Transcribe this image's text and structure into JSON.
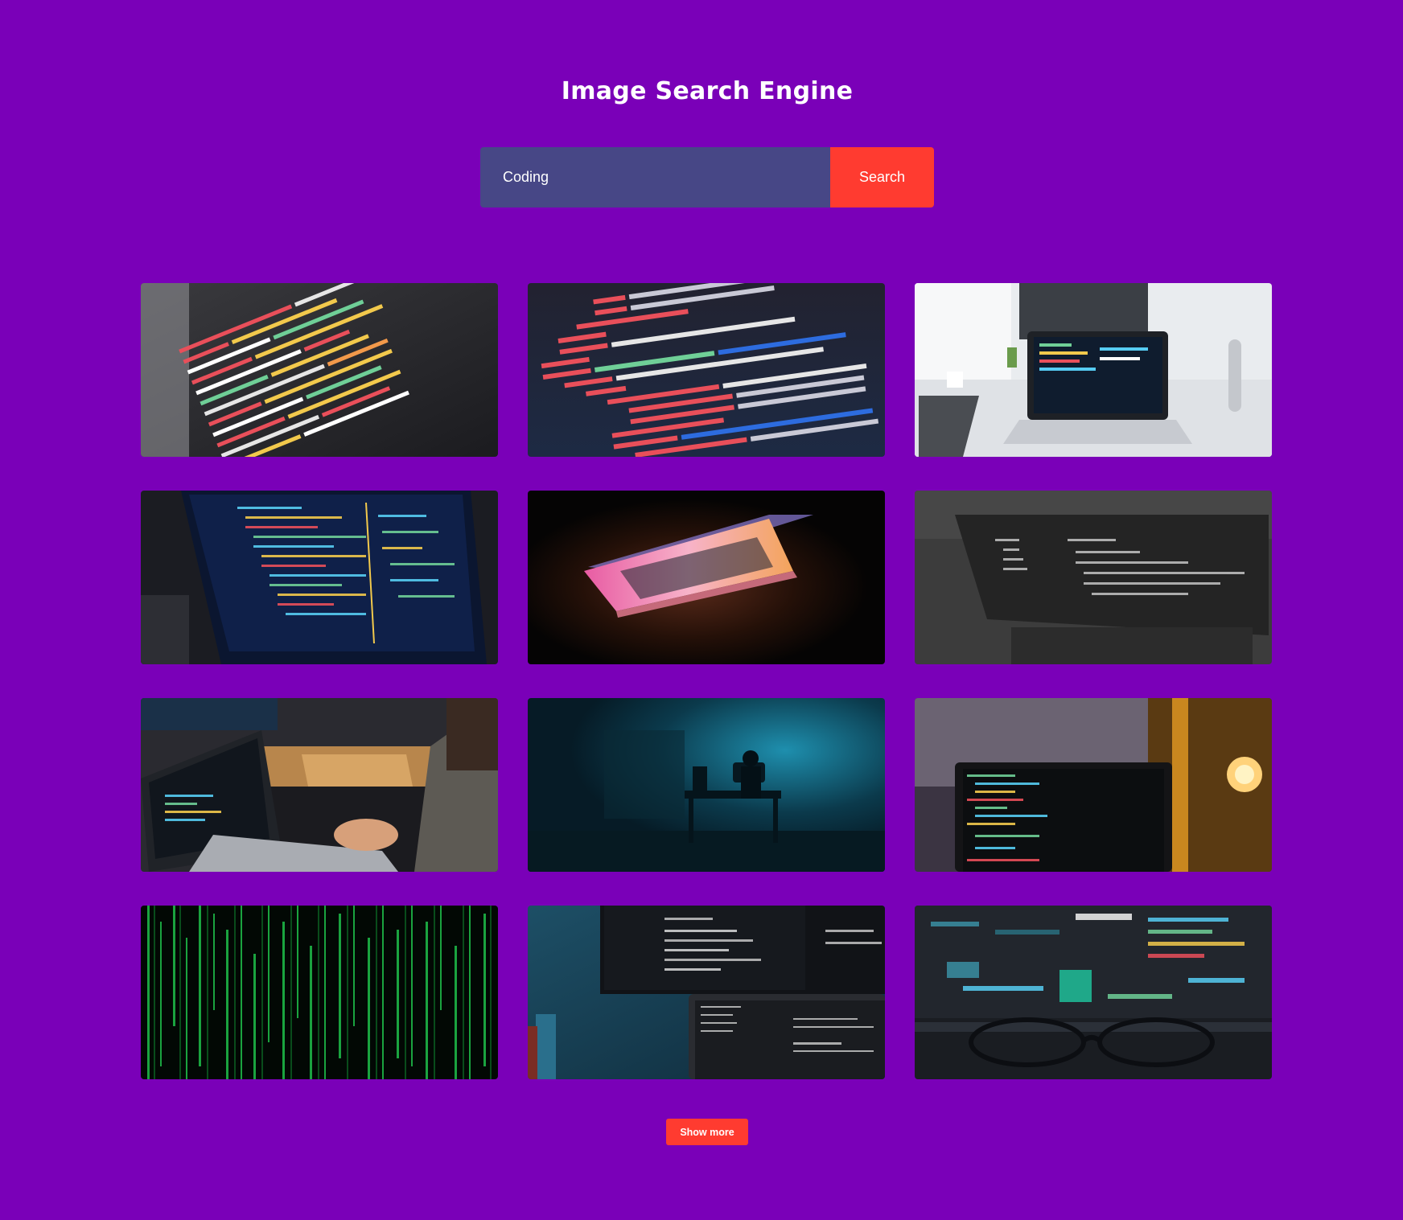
{
  "header": {
    "title": "Image Search Engine"
  },
  "search": {
    "value": "Coding",
    "button_label": "Search"
  },
  "results": [
    {
      "subject": "code editor closeup with colorful syntax"
    },
    {
      "subject": "svg markup code on dark screen"
    },
    {
      "subject": "laptop on white desk by window"
    },
    {
      "subject": "laptop screen with blue code editor"
    },
    {
      "subject": "half-open laptop glowing pink light in dark"
    },
    {
      "subject": "grayscale laptop with code"
    },
    {
      "subject": "person coding on laptop at wooden desk"
    },
    {
      "subject": "hooded figure at desk in dark blue room"
    },
    {
      "subject": "laptop with code next to glowing bulb"
    },
    {
      "subject": "green matrix code rain"
    },
    {
      "subject": "monitor and laptop with code blue wall"
    },
    {
      "subject": "glasses in front of monitor with code"
    }
  ],
  "footer": {
    "show_more_label": "Show more"
  }
}
